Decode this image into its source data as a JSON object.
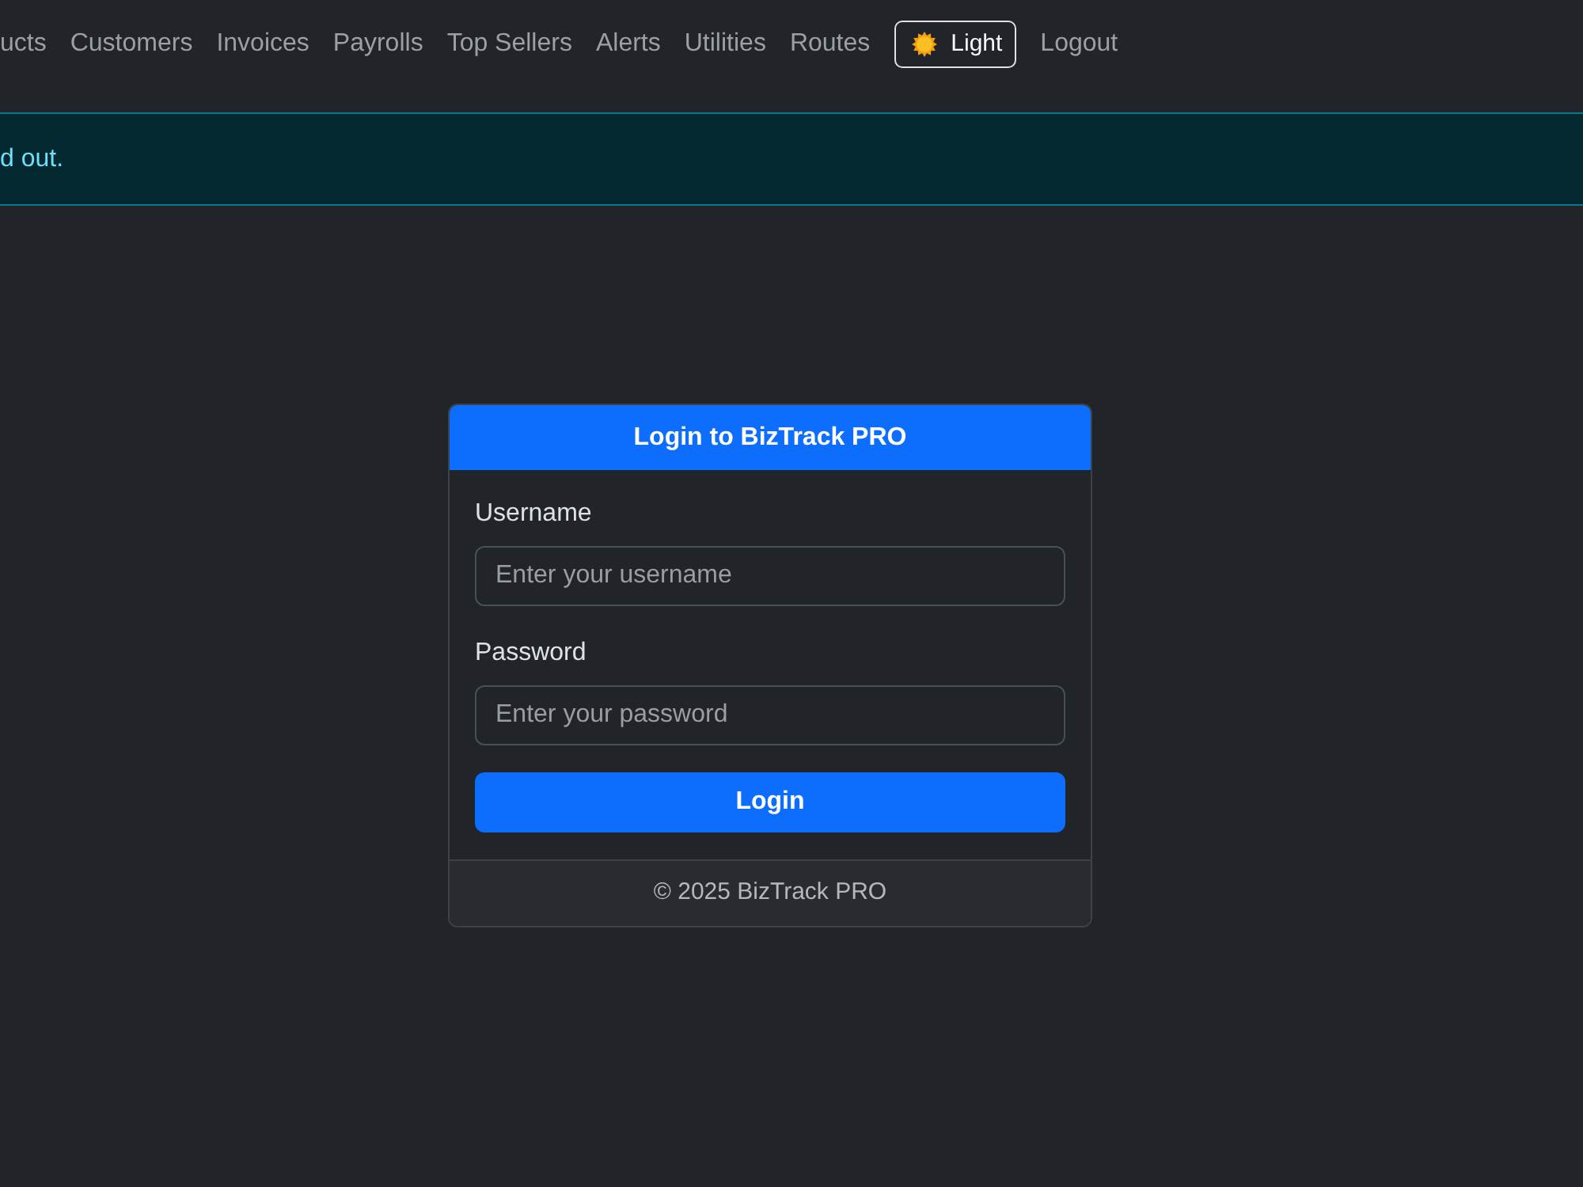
{
  "navbar": {
    "links": [
      {
        "label": "ucts"
      },
      {
        "label": "Customers"
      },
      {
        "label": "Invoices"
      },
      {
        "label": "Payrolls"
      },
      {
        "label": "Top Sellers"
      },
      {
        "label": "Alerts"
      },
      {
        "label": "Utilities"
      },
      {
        "label": "Routes"
      }
    ],
    "theme_toggle": {
      "label": "Light"
    },
    "logout": {
      "label": "Logout"
    }
  },
  "alert": {
    "message": "d out."
  },
  "login_card": {
    "title": "Login to BizTrack PRO",
    "fields": [
      {
        "label": "Username",
        "placeholder": "Enter your username"
      },
      {
        "label": "Password",
        "placeholder": "Enter your password"
      }
    ],
    "submit": "Login",
    "footer": "© 2025 BizTrack PRO"
  }
}
